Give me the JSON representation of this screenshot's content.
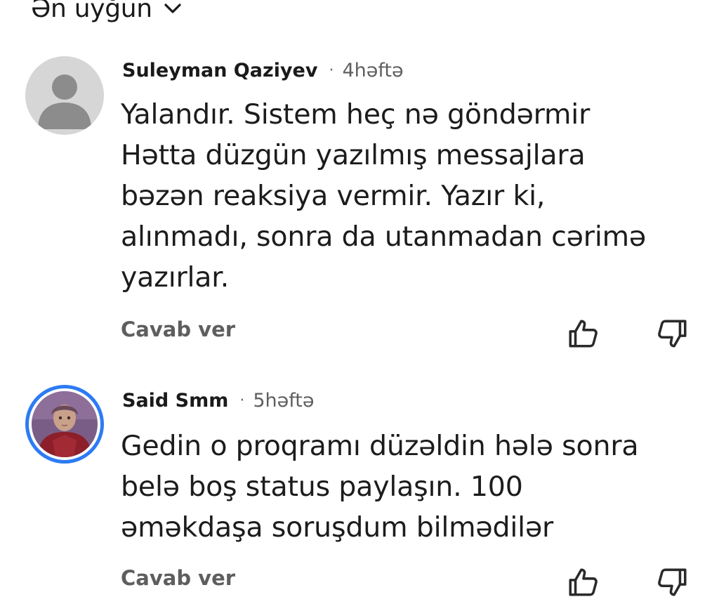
{
  "sort": {
    "label": "Ən uyğun",
    "icon": "chevron-down-icon"
  },
  "comments": [
    {
      "author": "Suleyman Qaziyev",
      "separator": "·",
      "time": "4həftə",
      "avatar": "default-avatar-icon",
      "text_lines": [
        "Yalandır. Sistem heç nə göndərmir",
        "Hətta düzgün yazılmış messajlara",
        "bəzən reaksiya vermir. Yazır ki,",
        "alınmadı, sonra da utanmadan cərimə",
        "yazırlar."
      ],
      "reply_label": "Cavab ver",
      "like_icon": "thumbs-up-icon",
      "dislike_icon": "thumbs-down-icon"
    },
    {
      "author": "Said Smm",
      "separator": "·",
      "time": "5həftə",
      "avatar": "profile-photo-avatar",
      "text_lines": [
        "Gedin o proqramı düzəldin hələ sonra",
        "belə boş status paylaşın. 100",
        "əməkdaşa soruşdum bilmədilər"
      ],
      "reply_label": "Cavab ver",
      "like_icon": "thumbs-up-icon",
      "dislike_icon": "thumbs-down-icon"
    }
  ],
  "colors": {
    "text": "#1c1c1c",
    "muted": "#5f5f5f",
    "avatar_ring": "#2d7bf4",
    "default_avatar_bg": "#d6d6d6",
    "default_avatar_fg": "#8a8a8a"
  }
}
